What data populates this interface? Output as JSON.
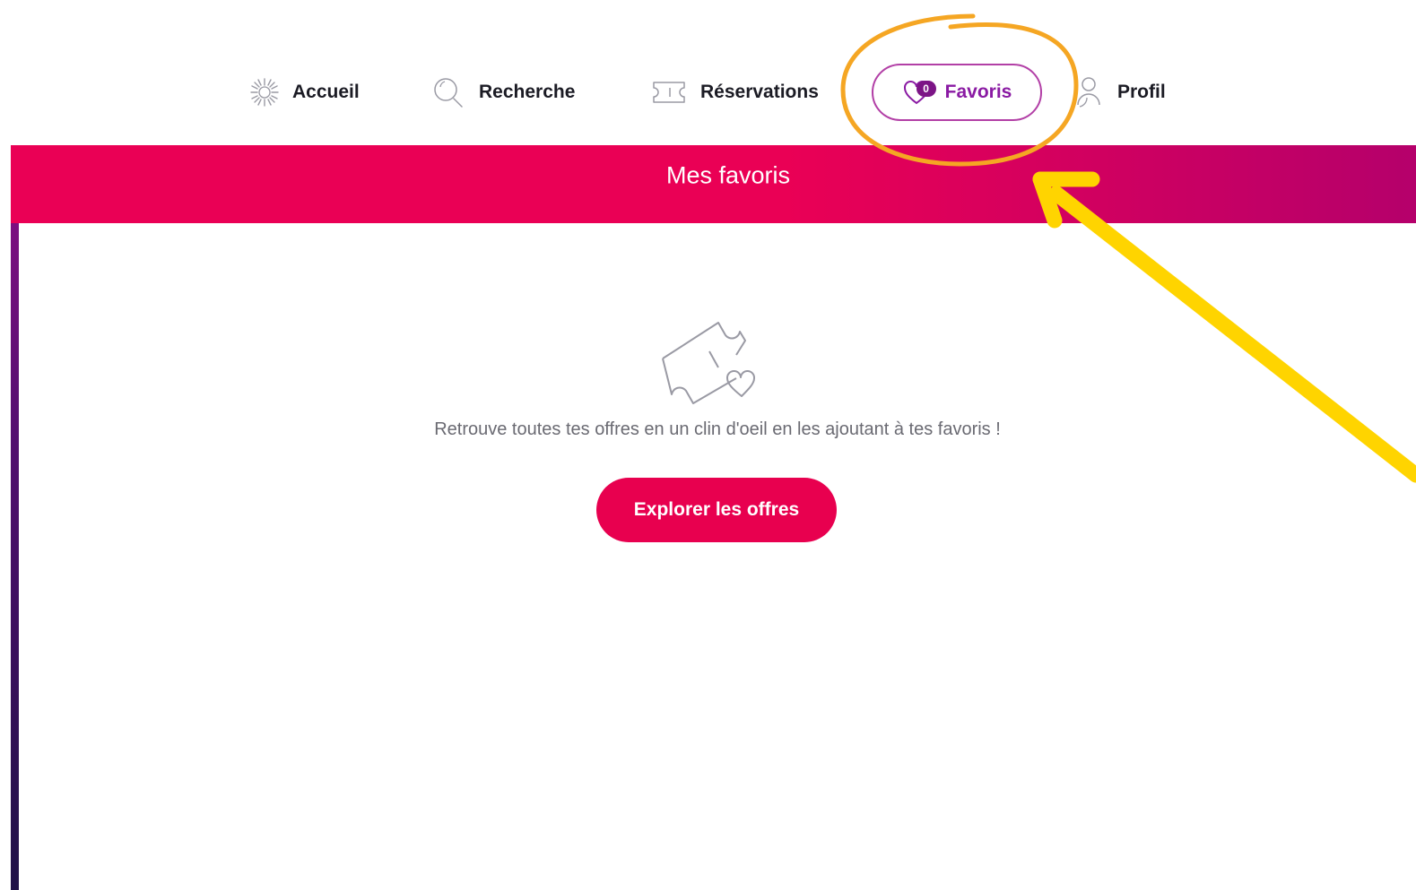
{
  "nav": {
    "items": [
      {
        "label": "Accueil",
        "icon": "home-sun-icon"
      },
      {
        "label": "Recherche",
        "icon": "search-icon"
      },
      {
        "label": "Réservations",
        "icon": "ticket-icon"
      },
      {
        "label": "Favoris",
        "icon": "heart-icon",
        "badge": "0",
        "active": true
      },
      {
        "label": "Profil",
        "icon": "user-icon"
      }
    ]
  },
  "header": {
    "title": "Mes favoris"
  },
  "empty_state": {
    "icon": "ticket-heart-icon",
    "message": "Retrouve toutes tes offres en un clin d'oeil en les ajoutant à tes favoris !",
    "button_label": "Explorer les offres"
  },
  "annotations": {
    "circle_color": "#f5a623",
    "arrow_color": "#ffd400"
  },
  "colors": {
    "brand_pink": "#e8004f",
    "brand_purple": "#8a1aa3",
    "text_dark": "#1b1b24",
    "text_muted": "#6a6a72"
  }
}
